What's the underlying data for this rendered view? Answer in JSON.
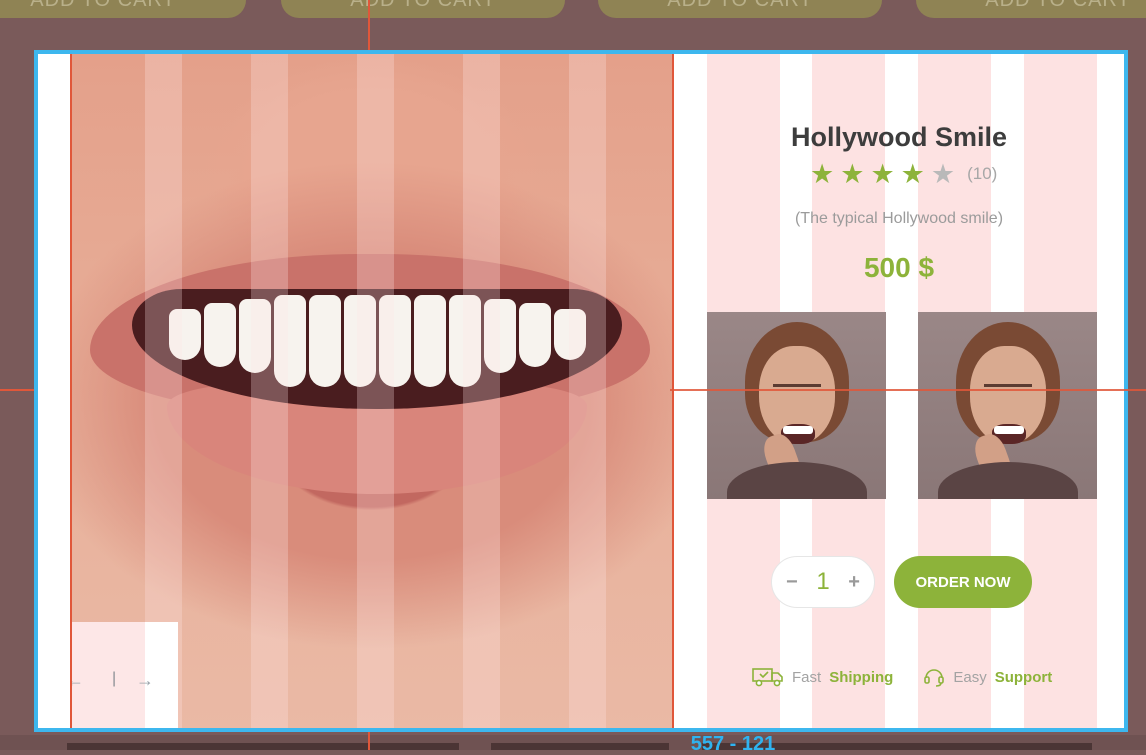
{
  "background": {
    "cart_buttons": [
      "ADD TO CART",
      "ADD TO CART",
      "ADD TO CART",
      "ADD TO CART"
    ],
    "partial_price": "557 - 121"
  },
  "modal": {
    "title": "Hollywood Smile",
    "rating": {
      "value": 4,
      "max": 5,
      "count_text": "(10)"
    },
    "subtitle": "(The typical Hollywood smile)",
    "price": "500 $",
    "quantity": "1",
    "order_button": "ORDER NOW",
    "features": {
      "shipping_prefix": "Fast",
      "shipping_label": "Shipping",
      "support_prefix": "Easy",
      "support_label": "Support"
    },
    "gallery_nav": {
      "separator": "|"
    }
  },
  "colors": {
    "accent": "#8db33a",
    "modal_border": "#3db7ee",
    "guide": "#e0573a"
  },
  "icons": [
    "star-icon",
    "minus-icon",
    "plus-icon",
    "truck-icon",
    "headset-icon",
    "arrow-left-icon",
    "arrow-right-icon"
  ]
}
